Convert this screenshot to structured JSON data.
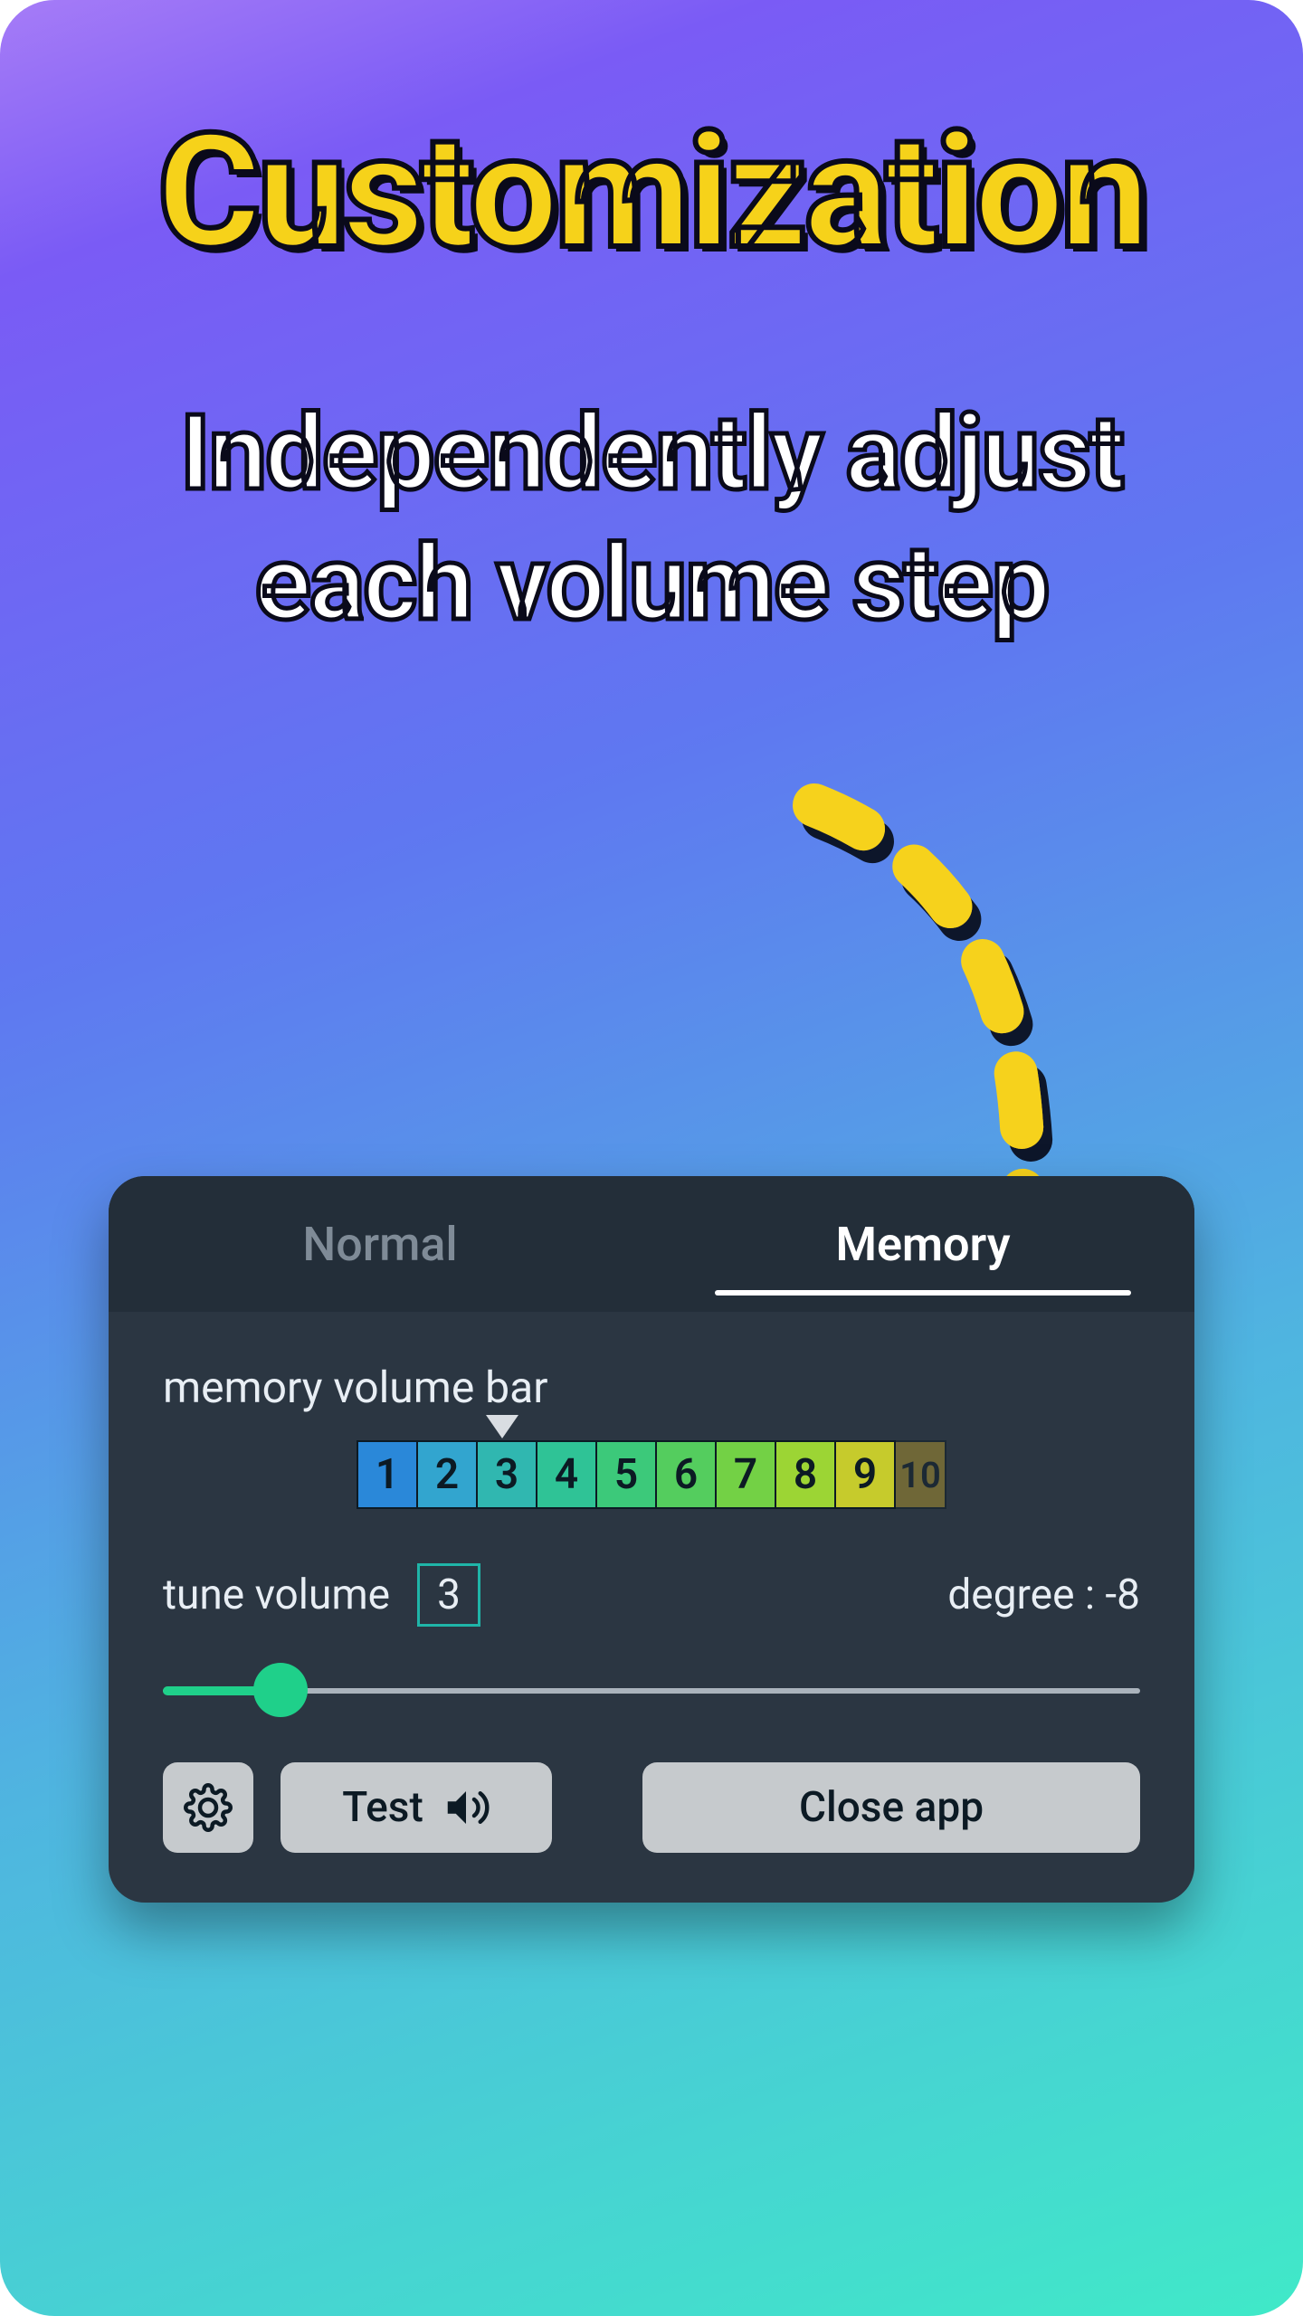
{
  "headline": "Customization",
  "subhead_line1": "Independently adjust",
  "subhead_line2": "each volume step",
  "panel": {
    "tabs": {
      "normal": "Normal",
      "memory": "Memory",
      "active": "memory"
    },
    "section_label": "memory volume bar",
    "volume_steps": [
      {
        "label": "1",
        "color": "#2a88d9"
      },
      {
        "label": "2",
        "color": "#32a5cf"
      },
      {
        "label": "3",
        "color": "#30b7b0"
      },
      {
        "label": "4",
        "color": "#2fc396"
      },
      {
        "label": "5",
        "color": "#3cc97a"
      },
      {
        "label": "6",
        "color": "#54cd5e"
      },
      {
        "label": "7",
        "color": "#73d145"
      },
      {
        "label": "8",
        "color": "#9cd534"
      },
      {
        "label": "9",
        "color": "#c6cb2c"
      },
      {
        "label": "10",
        "color": "#c2a32a"
      }
    ],
    "selected_step_index": 2,
    "tune_label": "tune volume",
    "tune_value": "3",
    "degree_label": "degree : -8",
    "degree_value": -8,
    "slider_percent": 12,
    "buttons": {
      "test": "Test",
      "close": "Close app"
    }
  }
}
